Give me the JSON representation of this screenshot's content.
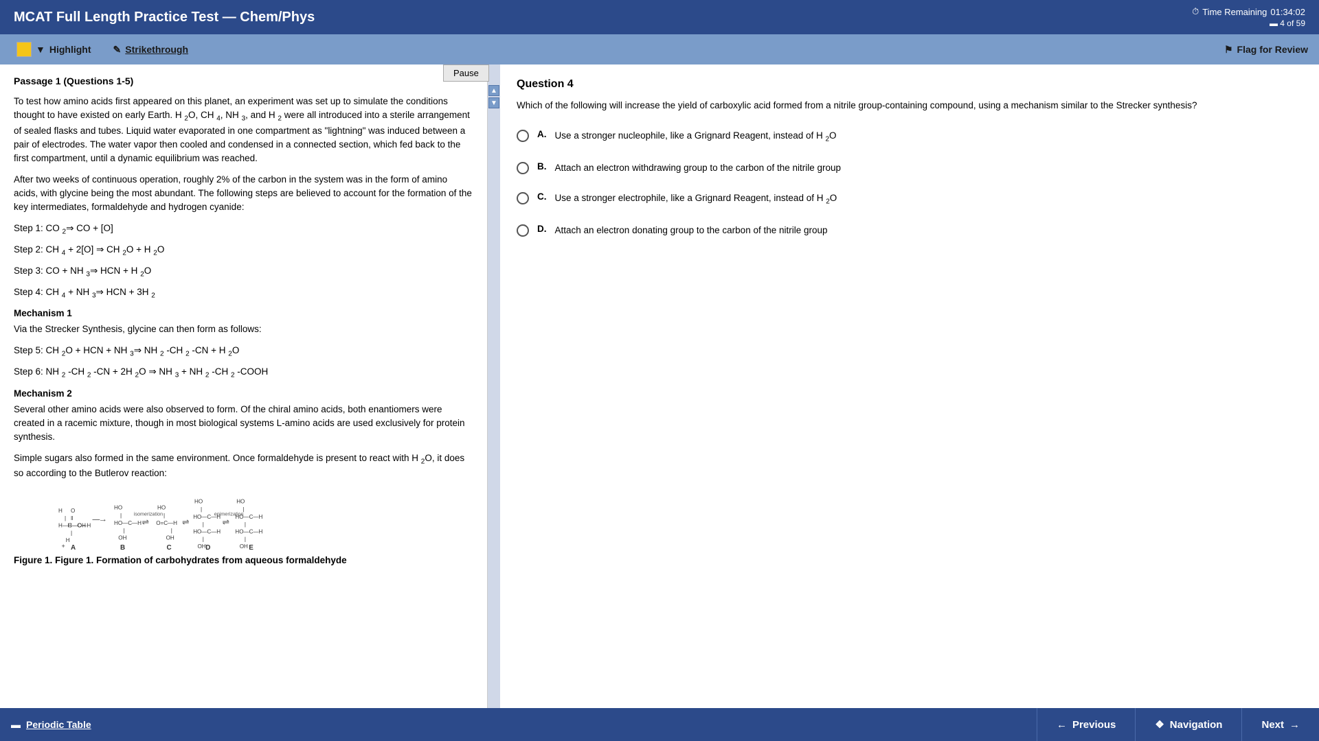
{
  "header": {
    "title": "MCAT Full Length Practice Test — Chem/Phys",
    "time_label": "Time Remaining",
    "time_value": "01:34:02",
    "question_count": "4 of 59"
  },
  "toolbar": {
    "highlight_label": "Highlight",
    "strikethrough_label": "Strikethrough",
    "flag_label": "Flag for Review"
  },
  "pause_button": "Pause",
  "passage": {
    "title": "Passage 1 (Questions 1-5)",
    "paragraphs": [
      "To test how amino acids first appeared on this planet, an experiment was set up to simulate the conditions thought to have existed on early Earth. H₂O, CH₄, NH₃, and H₂ were all introduced into a sterile arrangement of sealed flasks and tubes. Liquid water evaporated in one compartment as \"lightning\" was induced between a pair of electrodes. The water vapor then cooled and condensed in a connected section, which fed back to the first compartment, until a dynamic equilibrium was reached.",
      "After two weeks of continuous operation, roughly 2% of the carbon in the system was in the form of amino acids, with glycine being the most abundant. The following steps are believed to account for the formation of the key intermediates, formaldehyde and hydrogen cyanide:"
    ],
    "steps": [
      "Step 1: CO₂⇒ CO + [O]",
      "Step 2: CH₄ + 2[O] ⇒ CH₂O + H₂O",
      "Step 3: CO + NH₃⇒ HCN + H₂O",
      "Step 4: CH₄ + NH₃⇒ HCN + 3H₂"
    ],
    "mechanism1_title": "Mechanism 1",
    "mechanism1_intro": "Via the Strecker Synthesis, glycine can then form as follows:",
    "mechanism1_steps": [
      "Step 5: CH₂O + HCN + NH₃⇒ NH₂-CH₂-CN + H₂O",
      "Step 6: NH₂-CH₂-CN + 2H₂O ⇒ NH₃ + NH₂-CH₂-COOH"
    ],
    "mechanism2_title": "Mechanism 2",
    "mechanism2_paragraphs": [
      "Several other amino acids were also observed to form. Of the chiral amino acids, both enantiomers were created in a racemic mixture, though in most biological systems L-amino acids are used exclusively for protein synthesis.",
      "Simple sugars also formed in the same environment. Once formaldehyde is present to react with H₂O, it does so according to the Butlerov reaction:"
    ],
    "figure_caption": "Figure 1. Formation of carbohydrates from aqueous formaldehyde"
  },
  "question": {
    "number": "Question 4",
    "text": "Which of the following will increase the yield of carboxylic acid formed from a nitrile group-containing compound, using a mechanism similar to the Strecker synthesis?",
    "choices": [
      {
        "letter": "A.",
        "text": "Use a stronger nucleophile, like a Grignard Reagent, instead of H₂O"
      },
      {
        "letter": "B.",
        "text": "Attach an electron withdrawing group to the carbon of the nitrile group"
      },
      {
        "letter": "C.",
        "text": "Use a stronger electrophile, like a Grignard Reagent, instead of H₂O"
      },
      {
        "letter": "D.",
        "text": "Attach an electron donating group to the carbon of the nitrile group"
      }
    ]
  },
  "footer": {
    "periodic_table_label": "Periodic Table",
    "previous_label": "Previous",
    "navigation_label": "Navigation",
    "next_label": "Next"
  }
}
